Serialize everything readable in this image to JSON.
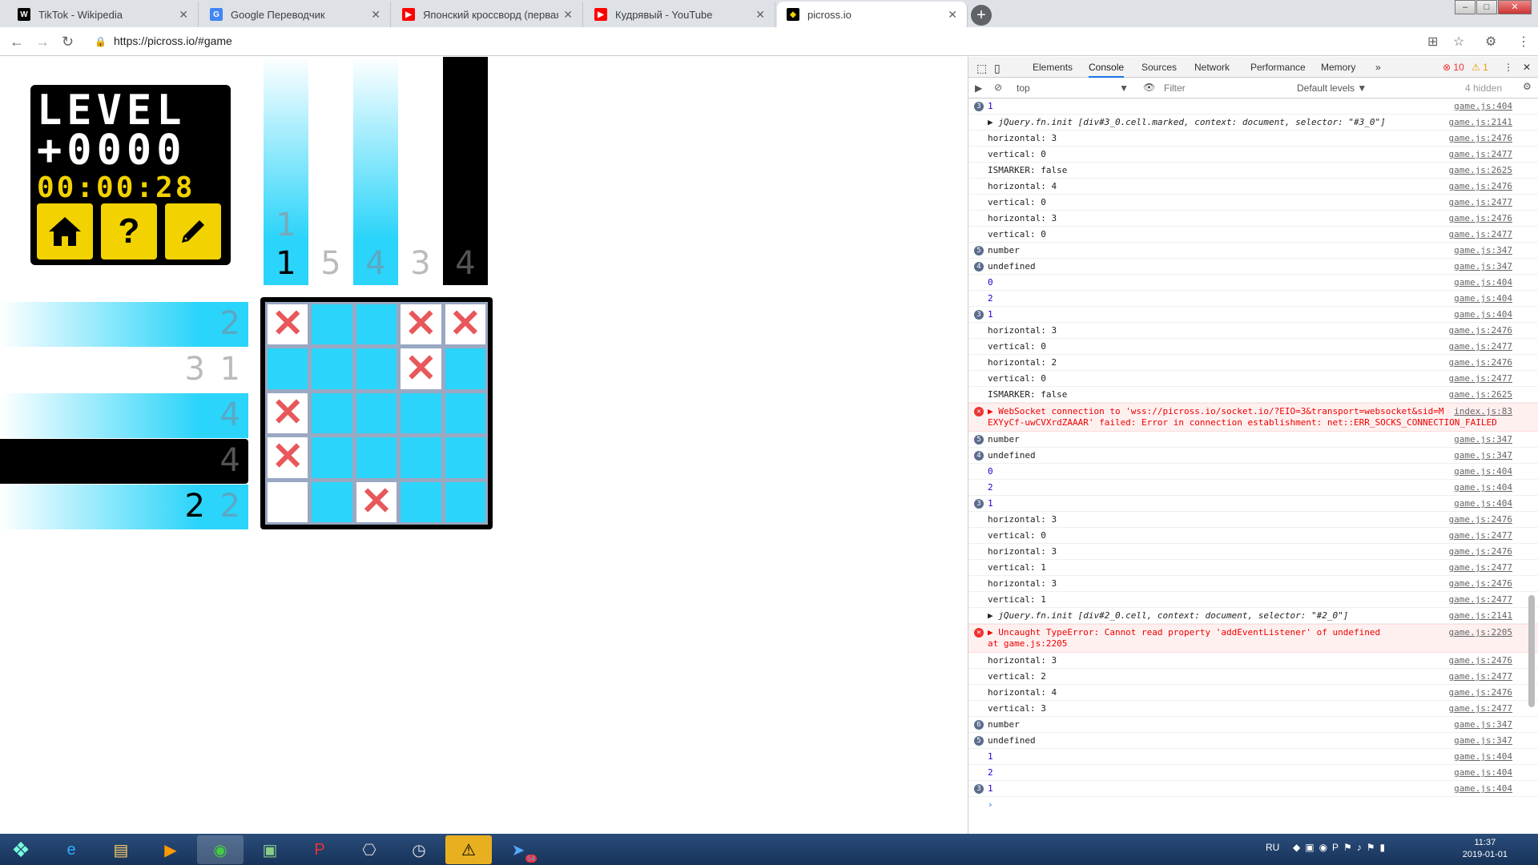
{
  "browser": {
    "tabs": [
      {
        "title": "TikTok - Wikipedia",
        "favicon": "W",
        "color": "#fff",
        "bg": "#000"
      },
      {
        "title": "Google Переводчик",
        "favicon": "G",
        "color": "#fff",
        "bg": "#4285f4"
      },
      {
        "title": "Японский кроссворд (первая с...",
        "favicon": "▶",
        "color": "#fff",
        "bg": "#f00"
      },
      {
        "title": "Кудрявый - YouTube",
        "favicon": "▶",
        "color": "#fff",
        "bg": "#f00"
      },
      {
        "title": "picross.io",
        "favicon": "◆",
        "color": "#f2d200",
        "bg": "#000"
      }
    ],
    "url": "https://picross.io/#game"
  },
  "game": {
    "level_line1": "LEVEL",
    "level_line2": "+0000",
    "timer": "00:00:28",
    "home_icon": "home-icon",
    "help_label": "?",
    "edit_icon": "pencil-icon",
    "columns": [
      {
        "clues": [
          "1",
          "1"
        ],
        "style": "highlight"
      },
      {
        "clues": [
          "5"
        ],
        "style": "plain"
      },
      {
        "clues": [
          "4"
        ],
        "style": "highlight"
      },
      {
        "clues": [
          "3"
        ],
        "style": "plain"
      },
      {
        "clues": [
          "4"
        ],
        "style": "dark"
      }
    ],
    "rows": [
      {
        "clues": [
          "2"
        ],
        "style": "highlight"
      },
      {
        "clues": [
          "3",
          "1"
        ],
        "style": "plain"
      },
      {
        "clues": [
          "4"
        ],
        "style": "highlight"
      },
      {
        "clues": [
          "4"
        ],
        "style": "dark"
      },
      {
        "clues": [
          "2",
          "2"
        ],
        "style": "highlight"
      }
    ],
    "grid": [
      [
        "x",
        "f",
        "f",
        "x",
        "x"
      ],
      [
        "f",
        "f",
        "f",
        "x",
        "f"
      ],
      [
        "x",
        "f",
        "f",
        "f",
        "f"
      ],
      [
        "x",
        "f",
        "f",
        "f",
        "f"
      ],
      [
        "w",
        "f",
        "x",
        "f",
        "f"
      ]
    ],
    "cross_mark": "✕"
  },
  "devtools": {
    "tabs": [
      "Elements",
      "Console",
      "Sources",
      "Network",
      "Performance",
      "Memory",
      "»"
    ],
    "errors": "10",
    "warnings": "1",
    "context": "top",
    "filter_placeholder": "Filter",
    "levels": "Default levels ▼",
    "hidden": "4 hidden",
    "prompt": "›",
    "lines": [
      {
        "badge": "3",
        "text": "1",
        "src": "game.js:404",
        "kind": "val"
      },
      {
        "text": "▶ jQuery.fn.init [div#3_0.cell.marked, context: document, selector: \"#3_0\"]",
        "src": "game.js:2141",
        "kind": "it"
      },
      {
        "text": "horizontal: 3",
        "src": "game.js:2476"
      },
      {
        "text": "vertical: 0",
        "src": "game.js:2477"
      },
      {
        "text": "ISMARKER: false",
        "src": "game.js:2625"
      },
      {
        "text": "horizontal: 4",
        "src": "game.js:2476"
      },
      {
        "text": "vertical: 0",
        "src": "game.js:2477"
      },
      {
        "text": "horizontal: 3",
        "src": "game.js:2476"
      },
      {
        "text": "vertical: 0",
        "src": "game.js:2477"
      },
      {
        "badge": "5",
        "text": "number",
        "src": "game.js:347"
      },
      {
        "badge": "4",
        "text": "undefined",
        "src": "game.js:347"
      },
      {
        "text": "0",
        "src": "game.js:404",
        "kind": "val"
      },
      {
        "text": "2",
        "src": "game.js:404",
        "kind": "val"
      },
      {
        "badge": "3",
        "text": "1",
        "src": "game.js:404",
        "kind": "val"
      },
      {
        "text": "horizontal: 3",
        "src": "game.js:2476"
      },
      {
        "text": "vertical: 0",
        "src": "game.js:2477"
      },
      {
        "text": "horizontal: 2",
        "src": "game.js:2476"
      },
      {
        "text": "vertical: 0",
        "src": "game.js:2477"
      },
      {
        "text": "ISMARKER: false",
        "src": "game.js:2625"
      },
      {
        "err": true,
        "text": "▶ WebSocket connection to 'wss://picross.io/socket.io/?EIO=3&transport=websocket&sid=M",
        "text2": "EXYyCf-uwCVXrdZAAAR' failed: Error in connection establishment: net::ERR_SOCKS_CONNECTION_FAILED",
        "src": "index.js:83"
      },
      {
        "badge": "5",
        "text": "number",
        "src": "game.js:347"
      },
      {
        "badge": "4",
        "text": "undefined",
        "src": "game.js:347"
      },
      {
        "text": "0",
        "src": "game.js:404",
        "kind": "val"
      },
      {
        "text": "2",
        "src": "game.js:404",
        "kind": "val"
      },
      {
        "badge": "3",
        "text": "1",
        "src": "game.js:404",
        "kind": "val"
      },
      {
        "text": "horizontal: 3",
        "src": "game.js:2476"
      },
      {
        "text": "vertical: 0",
        "src": "game.js:2477"
      },
      {
        "text": "horizontal: 3",
        "src": "game.js:2476"
      },
      {
        "text": "vertical: 1",
        "src": "game.js:2477"
      },
      {
        "text": "horizontal: 3",
        "src": "game.js:2476"
      },
      {
        "text": "vertical: 1",
        "src": "game.js:2477"
      },
      {
        "text": "▶ jQuery.fn.init [div#2_0.cell, context: document, selector: \"#2_0\"]",
        "src": "game.js:2141",
        "kind": "it"
      },
      {
        "err": true,
        "text": "▶ Uncaught TypeError: Cannot read property 'addEventListener' of undefined",
        "text2": "    at game.js:2205",
        "src": "game.js:2205"
      },
      {
        "text": "horizontal: 3",
        "src": "game.js:2476"
      },
      {
        "text": "vertical: 2",
        "src": "game.js:2477"
      },
      {
        "text": "horizontal: 4",
        "src": "game.js:2476"
      },
      {
        "text": "vertical: 3",
        "src": "game.js:2477"
      },
      {
        "badge": "6",
        "text": "number",
        "src": "game.js:347"
      },
      {
        "badge": "5",
        "text": "undefined",
        "src": "game.js:347"
      },
      {
        "text": "1",
        "src": "game.js:404",
        "kind": "val"
      },
      {
        "text": "2",
        "src": "game.js:404",
        "kind": "val"
      },
      {
        "badge": "3",
        "text": "1",
        "src": "game.js:404",
        "kind": "val"
      }
    ]
  },
  "taskbar": {
    "lang": "RU",
    "time": "11:37",
    "date": "2019-01-01",
    "telegram_badge": "54"
  }
}
